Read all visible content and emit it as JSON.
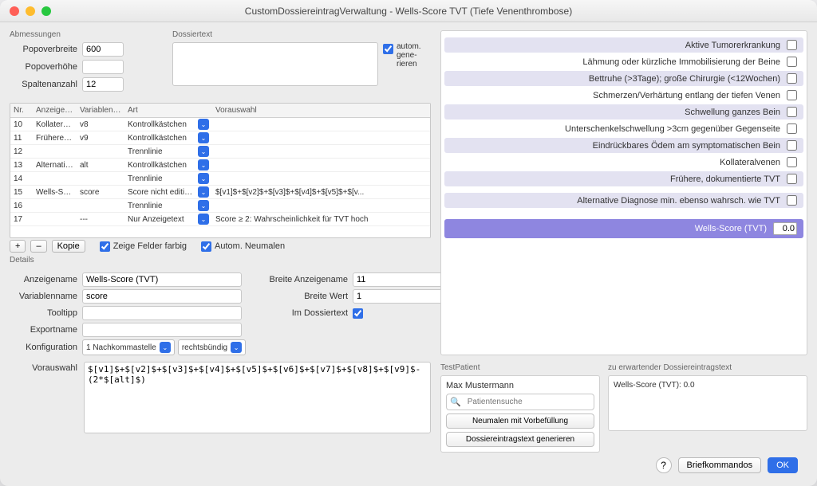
{
  "window": {
    "title": "CustomDossiereintragVerwaltung - Wells-Score TVT (Tiefe Venenthrombose)"
  },
  "abmessungen": {
    "label": "Abmessungen",
    "popoverbreite_label": "Popoverbreite",
    "popoverbreite": "600",
    "popoverhoehe_label": "Popoverhöhe",
    "popoverhoehe": "",
    "spaltenanzahl_label": "Spaltenanzahl",
    "spaltenanzahl": "12"
  },
  "dossiertext": {
    "label": "Dossiertext",
    "value": "",
    "autom_label": "autom. gene-rieren"
  },
  "table": {
    "headers": {
      "nr": "Nr.",
      "anzeigename": "Anzeigename",
      "variablenname": "Variablenname",
      "art": "Art",
      "vorauswahl": "Vorauswahl"
    },
    "rows": [
      {
        "nr": "10",
        "name": "Kollateralv...",
        "var": "v8",
        "art": "Kontrollkästchen",
        "pre": ""
      },
      {
        "nr": "11",
        "name": "Frühere, d...",
        "var": "v9",
        "art": "Kontrollkästchen",
        "pre": ""
      },
      {
        "nr": "12",
        "name": "",
        "var": "",
        "art": "Trennlinie",
        "pre": ""
      },
      {
        "nr": "13",
        "name": "Alternative...",
        "var": "alt",
        "art": "Kontrollkästchen",
        "pre": ""
      },
      {
        "nr": "14",
        "name": "",
        "var": "",
        "art": "Trennlinie",
        "pre": ""
      },
      {
        "nr": "15",
        "name": "Wells-Sco...",
        "var": "score",
        "art": "Score nicht editierba...",
        "pre": "$[v1]$+$[v2]$+$[v3]$+$[v4]$+$[v5]$+$[v..."
      },
      {
        "nr": "16",
        "name": "",
        "var": "",
        "art": "Trennlinie",
        "pre": ""
      },
      {
        "nr": "17",
        "name": "",
        "var": "---",
        "art": "Nur Anzeigetext",
        "pre": "Score ≥ 2: Wahrscheinlichkeit für TVT hoch"
      }
    ]
  },
  "table_controls": {
    "plus": "+",
    "minus": "–",
    "kopie": "Kopie",
    "zeige_felder_farbig": "Zeige Felder farbig",
    "autom_neumalen": "Autom. Neumalen"
  },
  "details": {
    "label": "Details",
    "anzeigename_label": "Anzeigename",
    "anzeigename": "Wells-Score (TVT)",
    "variablenname_label": "Variablenname",
    "variablenname": "score",
    "tooltipp_label": "Tooltipp",
    "tooltipp": "",
    "exportname_label": "Exportname",
    "exportname": "",
    "konfiguration_label": "Konfiguration",
    "konfiguration_decimals": "1 Nachkommastelle",
    "konfiguration_align": "rechtsbündig",
    "breite_anzeigename_label": "Breite Anzeigename",
    "breite_anzeigename": "11",
    "breite_wert_label": "Breite Wert",
    "breite_wert": "1",
    "im_dossiertext_label": "Im Dossiertext",
    "vorauswahl_label": "Vorauswahl",
    "vorauswahl": "$[v1]$+$[v2]$+$[v3]$+$[v4]$+$[v5]$+$[v6]$+$[v7]$+$[v8]$+$[v9]$-(2*$[alt]$)"
  },
  "preview": {
    "items": [
      "Aktive Tumorerkrankung",
      "Lähmung oder kürzliche Immobilisierung der Beine",
      "Bettruhe (>3Tage); große Chirurgie (<12Wochen)",
      "Schmerzen/Verhärtung entlang der tiefen Venen",
      "Schwellung ganzes Bein",
      "Unterschenkelschwellung >3cm gegenüber Gegenseite",
      "Eindrückbares Ödem am symptomatischen Bein",
      "Kollateralvenen",
      "Frühere, dokumentierte TVT"
    ],
    "alternative": "Alternative Diagnose min. ebenso wahrsch. wie TVT",
    "score_label": "Wells-Score (TVT)",
    "score_value": "0.0"
  },
  "testpatient": {
    "label": "TestPatient",
    "name": "Max Mustermann",
    "search_placeholder": "Patientensuche",
    "neumalen_btn": "Neumalen mit Vorbefüllung",
    "generieren_btn": "Dossiereintragstext generieren",
    "expected_label": "zu erwartender Dossiereintragstext",
    "expected_text": "Wells-Score (TVT): 0.0"
  },
  "footer": {
    "help": "?",
    "briefkommandos": "Briefkommandos",
    "ok": "OK"
  }
}
